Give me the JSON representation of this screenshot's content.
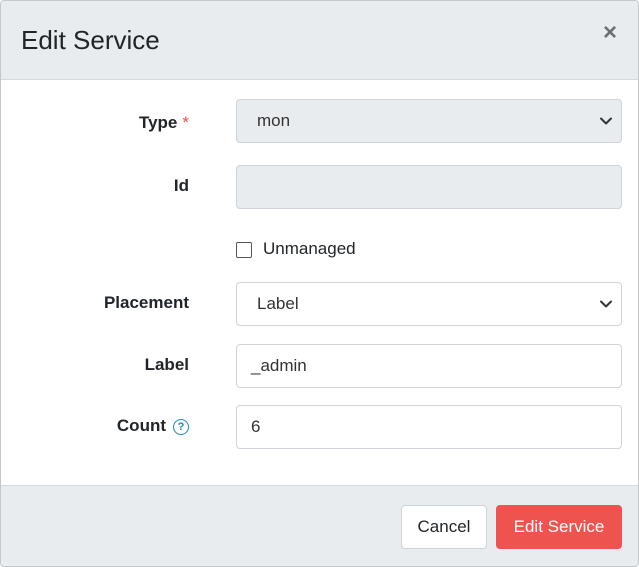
{
  "modal": {
    "title": "Edit Service",
    "close_label": "×"
  },
  "form": {
    "type": {
      "label": "Type",
      "required_mark": "*",
      "value": "mon",
      "disabled": true
    },
    "id": {
      "label": "Id",
      "value": "",
      "disabled": true
    },
    "unmanaged": {
      "label": "Unmanaged",
      "checked": false
    },
    "placement": {
      "label": "Placement",
      "value": "Label"
    },
    "label_field": {
      "label": "Label",
      "value": "_admin"
    },
    "count": {
      "label": "Count",
      "help_icon": "question-circle-icon",
      "help_glyph": "?",
      "value": "6"
    }
  },
  "footer": {
    "cancel_label": "Cancel",
    "submit_label": "Edit Service"
  },
  "colors": {
    "header_bg": "#e9ecef",
    "required": "#e4504b",
    "help": "#1a8db0",
    "primary_button": "#ef5350"
  }
}
